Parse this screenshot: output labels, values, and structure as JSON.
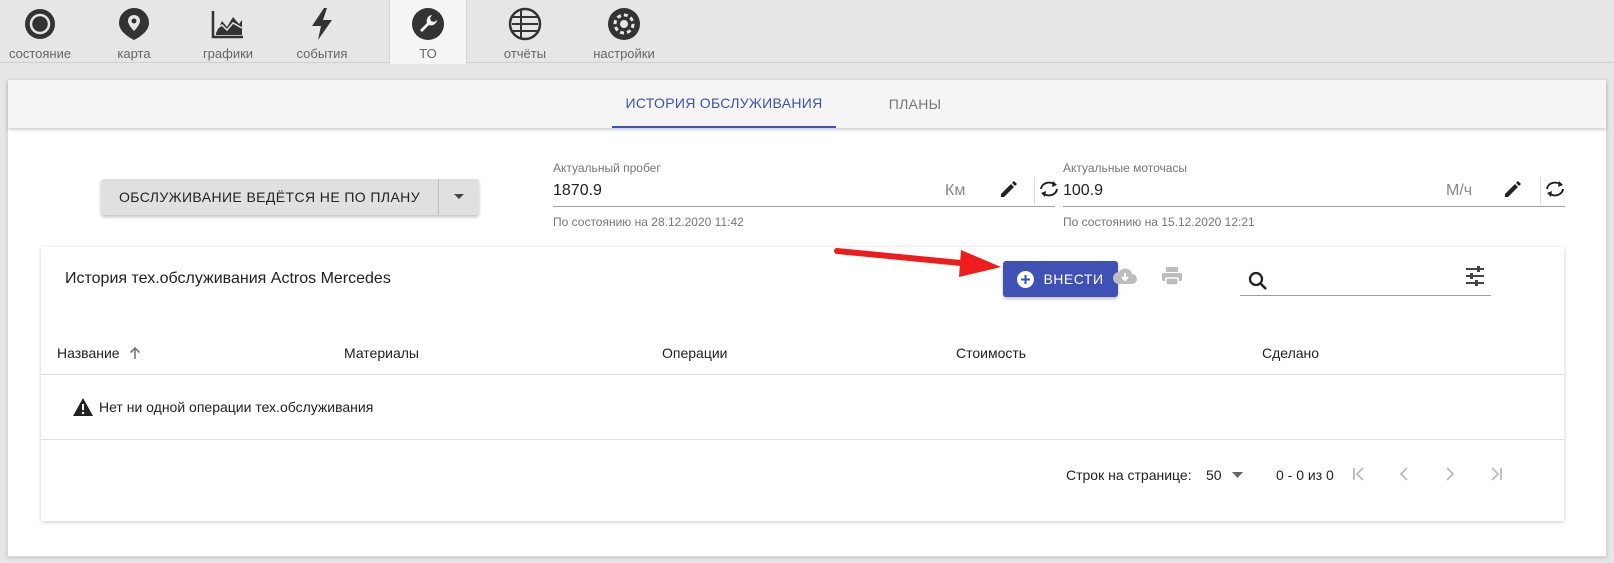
{
  "nav": {
    "items": [
      {
        "label": "состояние",
        "icon": "circle-icon"
      },
      {
        "label": "карта",
        "icon": "map-pin-icon"
      },
      {
        "label": "графики",
        "icon": "chart-icon"
      },
      {
        "label": "события",
        "icon": "lightning-icon"
      },
      {
        "label": "ТО",
        "icon": "wrench-icon",
        "active": true
      },
      {
        "label": "отчёты",
        "icon": "report-icon"
      },
      {
        "label": "настройки",
        "icon": "gear-icon"
      }
    ]
  },
  "subtabs": {
    "history": "ИСТОРИЯ ОБСЛУЖИВАНИЯ",
    "plans": "ПЛАНЫ"
  },
  "plan_button": {
    "label": "ОБСЛУЖИВАНИЕ ВЕДЁТСЯ НЕ ПО ПЛАНУ"
  },
  "mileage": {
    "label": "Актуальный пробег",
    "value": "1870.9",
    "unit": "Км",
    "helper": "По состоянию на 28.12.2020 11:42"
  },
  "engine_hours": {
    "label": "Актуальные моточасы",
    "value": "100.9",
    "unit": "М/ч",
    "helper": "По состоянию на 15.12.2020 12:21"
  },
  "table": {
    "title": "История тех.обслуживания Actros Mercedes",
    "add_label": "ВНЕСТИ",
    "search_value": "",
    "columns": [
      "Название",
      "Материалы",
      "Операции",
      "Стоимость",
      "Сделано"
    ],
    "empty_text": "Нет ни одной операции тех.обслуживания",
    "rows_per_page_label": "Строк на странице:",
    "rows_per_page": "50",
    "range_text": "0 - 0 из 0"
  },
  "colors": {
    "accent": "#3f51b5",
    "annotation_arrow": "#ee1c1c"
  }
}
